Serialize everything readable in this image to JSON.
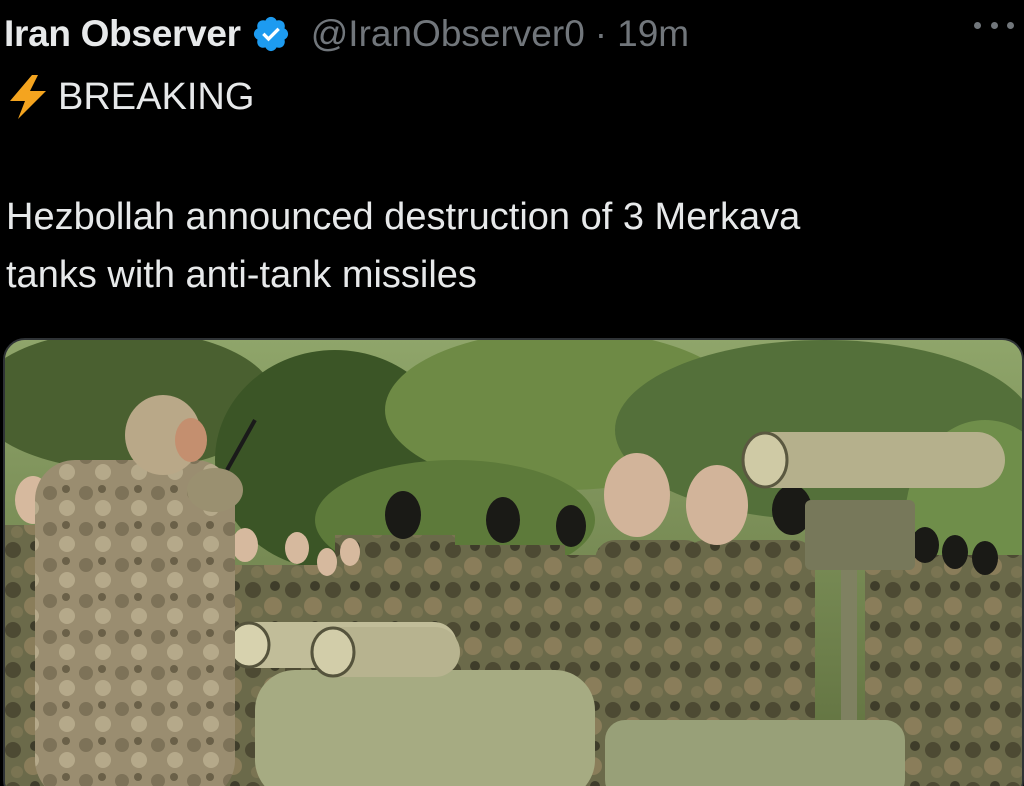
{
  "tweet": {
    "author_name": "Iran Observer",
    "handle": "@IranObserver0",
    "separator": "·",
    "time": "19m",
    "more_icon": "more-horizontal-icon",
    "verified_icon": "verified-badge-icon",
    "line1_icon": "lightning-bolt-icon",
    "line1_text": "BREAKING",
    "body_line1": "Hezbollah announced destruction of 3 Merkava",
    "body_line2": "tanks with anti-tank missiles",
    "media": {
      "type": "photo",
      "icon": "photo-image"
    }
  },
  "colors": {
    "background": "#000000",
    "text": "#e7e9ea",
    "secondary": "#71767b",
    "verified": "#1d9bf0",
    "bolt": "#f4a41f"
  }
}
